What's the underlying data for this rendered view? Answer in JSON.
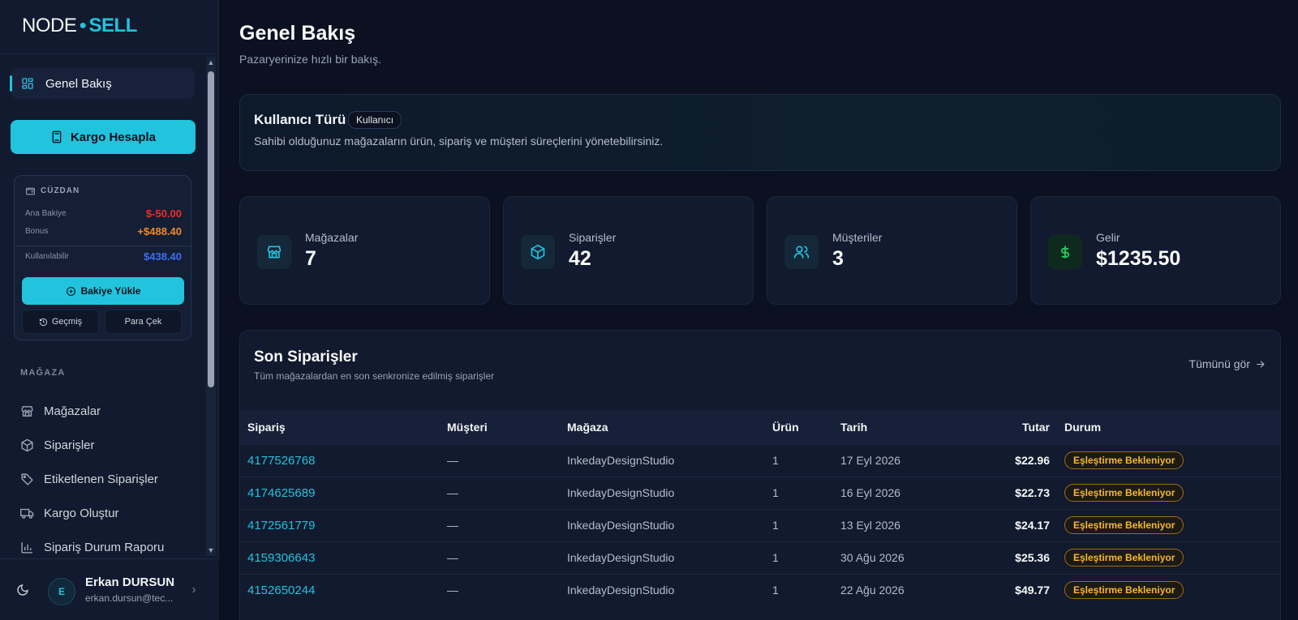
{
  "brand": {
    "part1": "NODE",
    "part2": "SELL"
  },
  "sidebar": {
    "active_item": "Genel Bakış",
    "cargo_button": "Kargo Hesapla",
    "wallet": {
      "title": "CÜZDAN",
      "rows": [
        {
          "label": "Ana Bakiye",
          "value": "$-50.00",
          "color": "#ef2b2b"
        },
        {
          "label": "Bonus",
          "value": "+$488.40",
          "color": "#f08a24"
        },
        {
          "label": "Kullanılabilir",
          "value": "$438.40",
          "color": "#3b6ef5"
        }
      ],
      "load_button": "Bakiye Yükle",
      "history_button": "Geçmiş",
      "withdraw_button": "Para Çek"
    },
    "section_label": "MAĞAZA",
    "items": [
      {
        "label": "Mağazalar",
        "icon": "store-icon"
      },
      {
        "label": "Siparişler",
        "icon": "package-icon"
      },
      {
        "label": "Etiketlenen Siparişler",
        "icon": "tag-icon"
      },
      {
        "label": "Kargo Oluştur",
        "icon": "truck-icon"
      },
      {
        "label": "Sipariş Durum Raporu",
        "icon": "bar-chart-icon"
      }
    ],
    "user": {
      "initial": "E",
      "name": "Erkan DURSUN",
      "email": "erkan.dursun@tec..."
    }
  },
  "main": {
    "title": "Genel Bakış",
    "subtitle": "Pazaryerinize hızlı bir bakış.",
    "user_type": {
      "title": "Kullanıcı Türü",
      "badge": "Kullanıcı",
      "description": "Sahibi olduğunuz mağazaların ürün, sipariş ve müşteri süreçlerini yönetebilirsiniz."
    },
    "stats": [
      {
        "label": "Mağazalar",
        "value": "7",
        "icon": "store-icon"
      },
      {
        "label": "Siparişler",
        "value": "42",
        "icon": "package-icon"
      },
      {
        "label": "Müşteriler",
        "value": "3",
        "icon": "users-icon"
      },
      {
        "label": "Gelir",
        "value": "$1235.50",
        "icon": "dollar-icon"
      }
    ],
    "orders": {
      "title": "Son Siparişler",
      "subtitle": "Tüm mağazalardan en son senkronize edilmiş siparişler",
      "view_all": "Tümünü gör",
      "columns": [
        "Sipariş",
        "Müşteri",
        "Mağaza",
        "Ürün",
        "Tarih",
        "Tutar",
        "Durum"
      ],
      "rows": [
        {
          "id": "4177526768",
          "customer": "—",
          "store": "InkedayDesignStudio",
          "items": "1",
          "date": "17 Eyl 2026",
          "amount": "$22.96",
          "status": "Eşleştirme Bekleniyor"
        },
        {
          "id": "4174625689",
          "customer": "—",
          "store": "InkedayDesignStudio",
          "items": "1",
          "date": "16 Eyl 2026",
          "amount": "$22.73",
          "status": "Eşleştirme Bekleniyor"
        },
        {
          "id": "4172561779",
          "customer": "—",
          "store": "InkedayDesignStudio",
          "items": "1",
          "date": "13 Eyl 2026",
          "amount": "$24.17",
          "status": "Eşleştirme Bekleniyor"
        },
        {
          "id": "4159306643",
          "customer": "—",
          "store": "InkedayDesignStudio",
          "items": "1",
          "date": "30 Ağu 2026",
          "amount": "$25.36",
          "status": "Eşleştirme Bekleniyor"
        },
        {
          "id": "4152650244",
          "customer": "—",
          "store": "InkedayDesignStudio",
          "items": "1",
          "date": "22 Ağu 2026",
          "amount": "$49.77",
          "status": "Eşleştirme Bekleniyor"
        }
      ]
    }
  }
}
